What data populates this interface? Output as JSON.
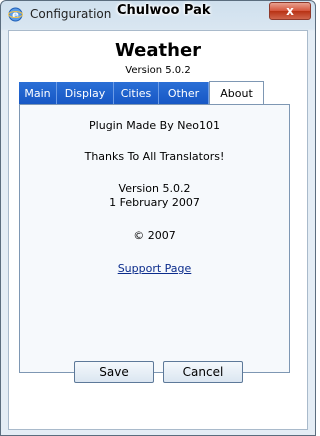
{
  "window": {
    "title": "Configuration",
    "user_label": "Chulwoo Pak",
    "close_glyph": "x"
  },
  "header": {
    "title": "Weather",
    "version": "Version 5.0.2"
  },
  "tabs": [
    {
      "label": "Main"
    },
    {
      "label": "Display"
    },
    {
      "label": "Cities"
    },
    {
      "label": "Other"
    },
    {
      "label": "About"
    }
  ],
  "about": {
    "made_by": "Plugin Made By Neo101",
    "thanks": "Thanks To All Translators!",
    "version": "Version 5.0.2",
    "date": "1 February 2007",
    "copyright": "© 2007",
    "support_link": "Support Page"
  },
  "buttons": {
    "save": "Save",
    "cancel": "Cancel"
  },
  "colors": {
    "tab_blue": "#1f63d1",
    "link": "#0b2c8c"
  }
}
